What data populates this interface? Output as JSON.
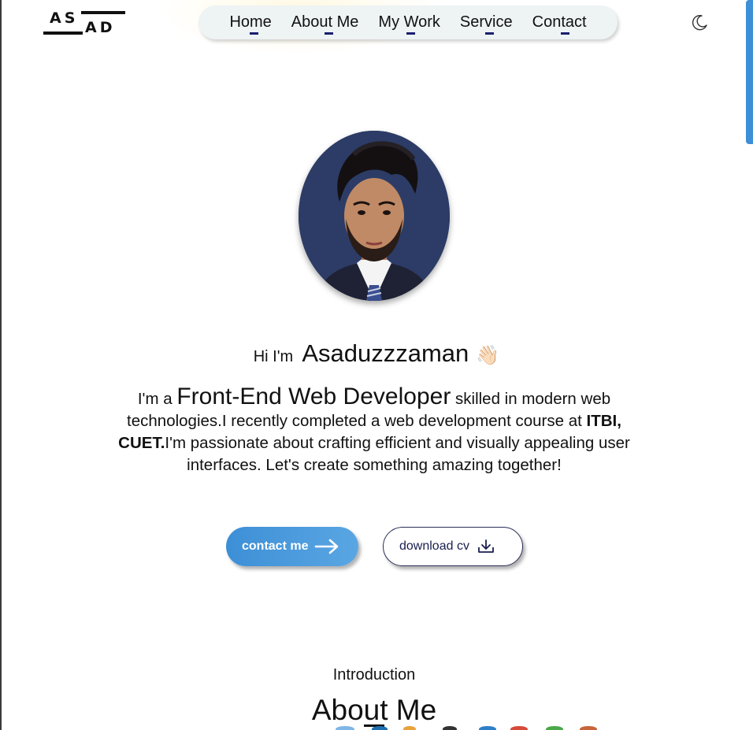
{
  "logo": {
    "top": "AS",
    "bottom": "AD"
  },
  "nav": {
    "items": [
      {
        "label": "Home"
      },
      {
        "label": "About Me"
      },
      {
        "label": "My Work"
      },
      {
        "label": "Service"
      },
      {
        "label": "Contact"
      }
    ]
  },
  "theme_toggle": {
    "icon": "moon-icon"
  },
  "hero": {
    "greeting_prefix": "Hi I'm",
    "name": "Asaduzzzaman",
    "wave_emoji": "👋🏻",
    "intro_prefix": "I'm a",
    "role": "Front-End Web Developer",
    "intro_part1": "skilled in modern web technologies.I recently completed a web development course at",
    "institution": "ITBI, CUET.",
    "intro_part2": "I'm passionate about crafting efficient and visually appealing user interfaces. Let's create something amazing together!",
    "contact_button": "contact me",
    "cv_button": "download cv"
  },
  "about": {
    "label": "Introduction",
    "title": "About Me"
  },
  "colors": {
    "accent": "#3d8fd6",
    "nav_bg": "#eef3f4",
    "underline": "#1a1f6e",
    "avatar_bg": "#2c3c66"
  }
}
